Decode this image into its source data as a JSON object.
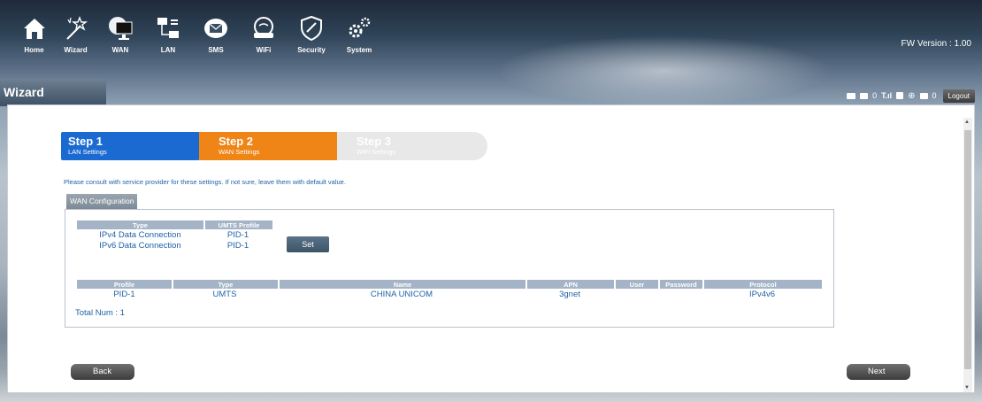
{
  "nav": {
    "items": [
      {
        "label": "Home",
        "icon": "home-icon"
      },
      {
        "label": "Wizard",
        "icon": "wand-icon"
      },
      {
        "label": "WAN",
        "icon": "globe-monitor-icon"
      },
      {
        "label": "LAN",
        "icon": "network-icon"
      },
      {
        "label": "SMS",
        "icon": "envelope-icon"
      },
      {
        "label": "WiFi",
        "icon": "router-icon"
      },
      {
        "label": "Security",
        "icon": "shield-icon"
      },
      {
        "label": "System",
        "icon": "gears-icon"
      }
    ],
    "fw_version": "FW Version : 1.00"
  },
  "page": {
    "title": "Wizard"
  },
  "status": {
    "sms_count": "0",
    "msg_count": "0",
    "logout_label": "Logout"
  },
  "steps": [
    {
      "title": "Step 1",
      "desc": "LAN Settings",
      "state": "done"
    },
    {
      "title": "Step 2",
      "desc": "WAN Settings",
      "state": "active"
    },
    {
      "title": "Step 3",
      "desc": "WiFi Settings",
      "state": "inactive"
    }
  ],
  "hint": "Please consult with service provider for these settings. If not sure, leave them with default value.",
  "wan": {
    "section_label": "WAN Configuration",
    "profile_table": {
      "headers": [
        "Type",
        "UMTS Profile"
      ],
      "rows": [
        [
          "IPv4 Data Connection",
          "PID-1"
        ],
        [
          "IPv6 Data Connection",
          "PID-1"
        ]
      ]
    },
    "set_label": "Set",
    "profiles_table": {
      "headers": [
        "Profile",
        "Type",
        "Name",
        "APN",
        "User",
        "Password",
        "Protocol"
      ],
      "rows": [
        [
          "PID-1",
          "UMTS",
          "CHINA UNICOM",
          "3gnet",
          "",
          "",
          "IPv4v6"
        ]
      ]
    },
    "total": "Total Num : 1"
  },
  "buttons": {
    "back": "Back",
    "next": "Next"
  },
  "colors": {
    "step1": "#1b6ad2",
    "step2": "#ee8516",
    "step3": "#e8e8e8",
    "link_text": "#1e62a8",
    "table_header": "#a4b3c6"
  }
}
